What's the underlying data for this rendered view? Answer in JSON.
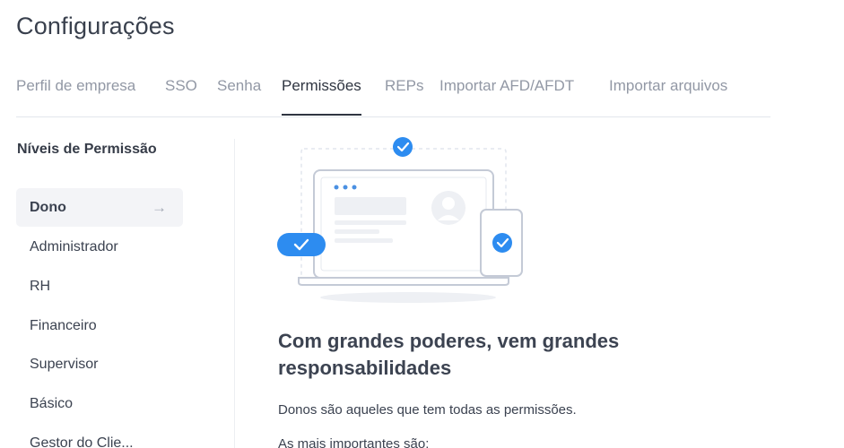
{
  "page": {
    "title": "Configurações"
  },
  "tabs": [
    {
      "label": "Perfil de empresa"
    },
    {
      "label": "SSO"
    },
    {
      "label": "Senha"
    },
    {
      "label": "Permissões",
      "active": true
    },
    {
      "label": "REPs"
    },
    {
      "label": "Importar AFD/AFDT"
    },
    {
      "label": "Importar arquivos"
    }
  ],
  "sidebar": {
    "title": "Níveis de Permissão",
    "items": [
      {
        "label": "Dono",
        "active": true,
        "icon": "arrow-right-icon",
        "arrow": "→"
      },
      {
        "label": "Administrador"
      },
      {
        "label": "RH"
      },
      {
        "label": "Financeiro"
      },
      {
        "label": "Supervisor"
      },
      {
        "label": "Básico"
      },
      {
        "label": "Gestor do Clie..."
      }
    ]
  },
  "content": {
    "illustration_icon": "devices-check-illustration",
    "heading": "Com grandes poderes, vem grandes responsabilidades",
    "paragraph": "Donos são aqueles que tem todas as permissões.",
    "list_intro": "As mais importantes são:"
  },
  "colors": {
    "accent": "#2d8cf0",
    "text_dark": "#2f3541",
    "text_muted": "#9298a5",
    "active_bg": "#f3f4f7"
  }
}
